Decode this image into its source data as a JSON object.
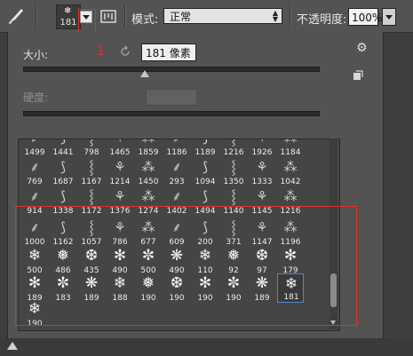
{
  "toolbar": {
    "brush_preset_size": "181",
    "mode_label": "模式:",
    "mode_value": "正常",
    "opacity_label": "不透明度:",
    "opacity_value": "100%"
  },
  "panel": {
    "size_label": "大小:",
    "annotation_marker": "1",
    "size_value": "181 像素",
    "hardness_label": "硬度:"
  },
  "brushes": [
    [
      "1499",
      "1441",
      "798",
      "1465",
      "1859",
      "1186",
      "1189",
      "1216",
      "1926",
      "1184"
    ],
    [
      "769",
      "1687",
      "1167",
      "1214",
      "1450",
      "293",
      "1094",
      "1350",
      "1333",
      "1042"
    ],
    [
      "914",
      "1338",
      "1172",
      "1376",
      "1274",
      "1402",
      "1494",
      "1140",
      "1145",
      "1216"
    ],
    [
      "1000",
      "1162",
      "1057",
      "786",
      "677",
      "609",
      "200",
      "371",
      "1147",
      "1196"
    ],
    [
      "500",
      "486",
      "435",
      "490",
      "500",
      "490",
      "110",
      "92",
      "97",
      "179"
    ],
    [
      "189",
      "183",
      "189",
      "188",
      "190",
      "190",
      "190",
      "190",
      "189",
      "181"
    ],
    [
      "190"
    ]
  ],
  "selected_brush": "181",
  "icons": [
    "brush-icon",
    "snowflake-icon",
    "chevron-down-icon",
    "toggle-panel-icon",
    "reset-icon",
    "gear-icon",
    "new-preset-icon"
  ]
}
